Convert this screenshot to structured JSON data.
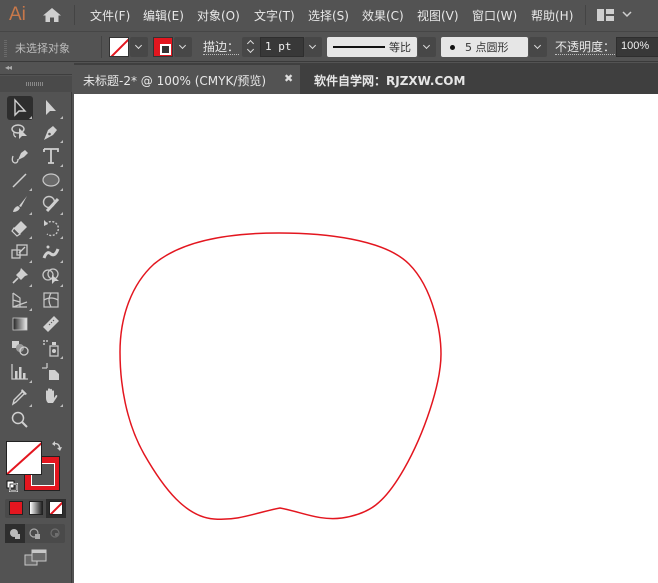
{
  "app": {
    "logo": "Ai"
  },
  "menubar": {
    "items": [
      {
        "label": "文件(F)"
      },
      {
        "label": "编辑(E)"
      },
      {
        "label": "对象(O)"
      },
      {
        "label": "文字(T)"
      },
      {
        "label": "选择(S)"
      },
      {
        "label": "效果(C)"
      },
      {
        "label": "视图(V)"
      },
      {
        "label": "窗口(W)"
      },
      {
        "label": "帮助(H)"
      }
    ],
    "workspace_icon": "workspace-layout-icon"
  },
  "controlbar": {
    "selection_status": "未选择对象",
    "fill": {
      "state": "none"
    },
    "stroke": {
      "color": "#e3161f"
    },
    "stroke_label": "描边：",
    "stroke_weight": "1 pt",
    "variable_width_profile": "等比",
    "brush_definition": "5 点圆形",
    "opacity_label": "不透明度：",
    "opacity_value": "100%"
  },
  "tabs": {
    "active": {
      "title": "未标题-2* @ 100% (CMYK/预览)",
      "close": "✖"
    },
    "inactive": {
      "title": "软件自学网：RJZXW.COM"
    }
  },
  "tools": [
    {
      "name": "selection-tool",
      "selected": true
    },
    {
      "name": "direct-selection-tool"
    },
    {
      "name": "lasso-tool"
    },
    {
      "name": "pen-tool"
    },
    {
      "name": "curvature-tool"
    },
    {
      "name": "type-tool"
    },
    {
      "name": "line-segment-tool"
    },
    {
      "name": "ellipse-tool"
    },
    {
      "name": "paintbrush-tool"
    },
    {
      "name": "shaper-tool"
    },
    {
      "name": "eraser-tool"
    },
    {
      "name": "rotate-tool"
    },
    {
      "name": "scale-tool"
    },
    {
      "name": "puppet-warp-tool"
    },
    {
      "name": "pin-tool"
    },
    {
      "name": "shape-builder-tool"
    },
    {
      "name": "perspective-grid-tool"
    },
    {
      "name": "mesh-tool"
    },
    {
      "name": "gradient-tool"
    },
    {
      "name": "measure-tool"
    },
    {
      "name": "blend-tool"
    },
    {
      "name": "symbol-sprayer-tool"
    },
    {
      "name": "column-graph-tool"
    },
    {
      "name": "artboard-tool"
    },
    {
      "name": "slice-tool"
    },
    {
      "name": "hand-tool"
    },
    {
      "name": "zoom-tool"
    }
  ],
  "colors": {
    "accent_red": "#e3161f",
    "ui_bg": "#535353",
    "canvas_bg": "#ffffff",
    "logo": "#c8784a"
  },
  "artwork": {
    "shape": "closed curved path (apple-like outline)",
    "stroke_color": "#e3161f",
    "fill": "none"
  }
}
